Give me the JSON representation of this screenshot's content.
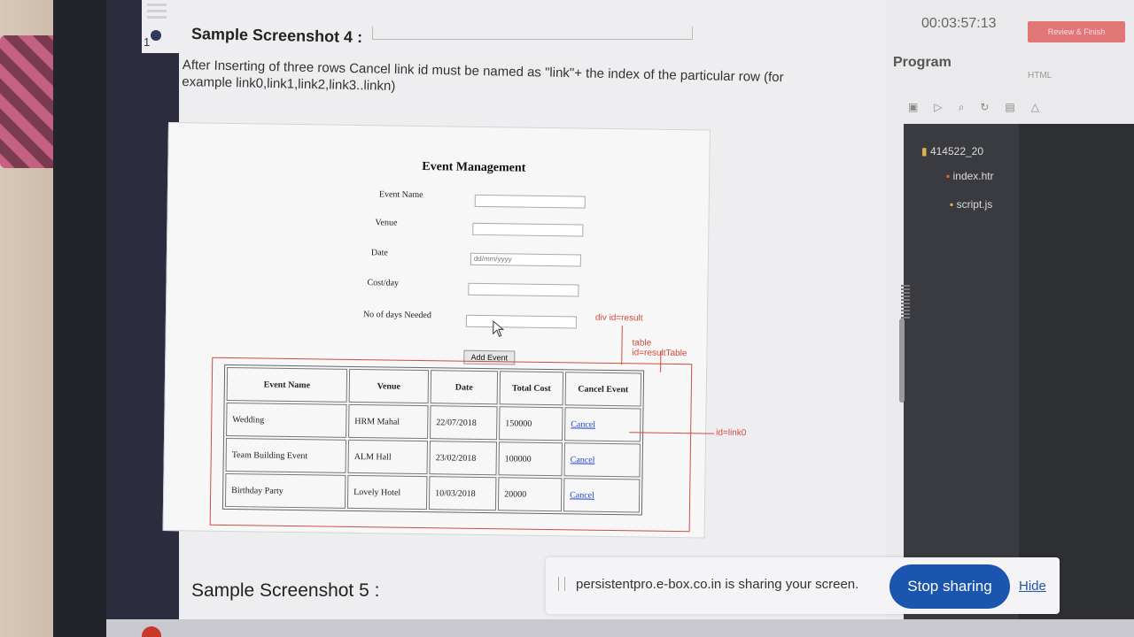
{
  "timer": "00:03:57:13",
  "review_button": "Review & Finish",
  "question_number": "1",
  "heading4": "Sample Screenshot 4 :",
  "description": "After Inserting of three rows Cancel link id must be named as \"link\"+ the index of the particular row (for example link0,link1,link2,link3..linkn)",
  "app": {
    "title": "Event Management",
    "fields": [
      {
        "label": "Event Name",
        "placeholder": ""
      },
      {
        "label": "Venue",
        "placeholder": ""
      },
      {
        "label": "Date",
        "placeholder": "dd/mm/yyyy"
      },
      {
        "label": "Cost/day",
        "placeholder": ""
      },
      {
        "label": "No of days Needed",
        "placeholder": ""
      }
    ],
    "add_button": "Add Event",
    "table": {
      "headers": [
        "Event Name",
        "Venue",
        "Date",
        "Total Cost",
        "Cancel Event"
      ],
      "rows": [
        [
          "Wedding",
          "HRM Mahal",
          "22/07/2018",
          "150000",
          "Cancel"
        ],
        [
          "Team Building Event",
          "ALM Hall",
          "23/02/2018",
          "100000",
          "Cancel"
        ],
        [
          "Birthday Party",
          "Lovely Hotel",
          "10/03/2018",
          "20000",
          "Cancel"
        ]
      ]
    }
  },
  "annotations": {
    "result_div": "div id=result",
    "result_table": "table id=resultTable",
    "link_id": "id=link0"
  },
  "program": {
    "title": "Program",
    "language": "HTML",
    "folder": "414522_20",
    "files": [
      "index.htr",
      "script.js"
    ]
  },
  "heading5": "Sample Screenshot 5 :",
  "share": {
    "message": "persistentpro.e-box.co.in is sharing your screen.",
    "stop_button": "Stop sharing",
    "hide_link": "Hide"
  },
  "colors": {
    "annotation_red": "#d24b3e",
    "stop_button_blue": "#1a55b0",
    "link_blue": "#2244cc",
    "sidebar_dark": "#2b2d3f"
  }
}
